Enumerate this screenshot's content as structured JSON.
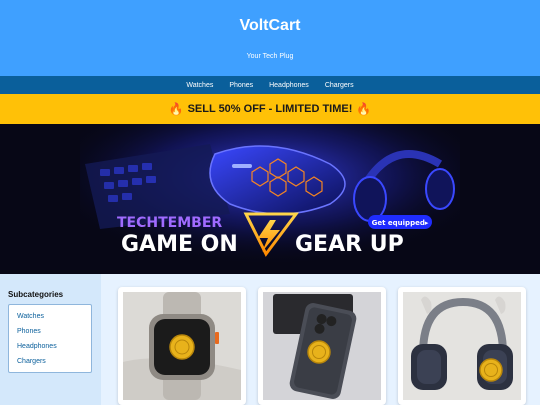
{
  "header": {
    "brand": "VoltCart",
    "tagline": "Your Tech Plug"
  },
  "nav": {
    "items": [
      {
        "label": "Watches"
      },
      {
        "label": "Phones"
      },
      {
        "label": "Headphones"
      },
      {
        "label": "Chargers"
      }
    ]
  },
  "promo": {
    "text": "SELL 50% OFF - LIMITED TIME!",
    "icon": "fire-icon"
  },
  "banner": {
    "kicker": "TECHTEMBER",
    "headline_left": "GAME ON",
    "headline_right": "GEAR UP",
    "cta": "Get equipped▸"
  },
  "sidebar": {
    "title": "Subcategories",
    "items": [
      {
        "label": "Watches"
      },
      {
        "label": "Phones"
      },
      {
        "label": "Headphones"
      },
      {
        "label": "Chargers"
      }
    ]
  },
  "products": [
    {
      "icon": "smartwatch-icon"
    },
    {
      "icon": "smartphone-icon"
    },
    {
      "icon": "headphones-icon"
    }
  ],
  "colors": {
    "header": "#3fa0ff",
    "nav": "#0a5f9b",
    "promo": "#ffc107",
    "banner_accent": "#1f2cff",
    "coin": "#e8b21b"
  }
}
